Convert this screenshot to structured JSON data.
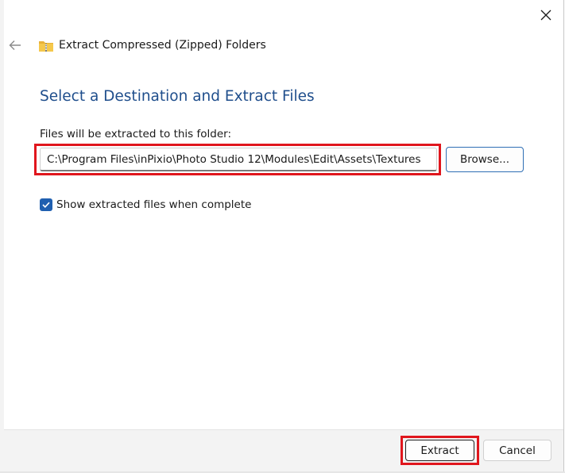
{
  "window": {
    "title": "Extract Compressed (Zipped) Folders",
    "back_icon": "arrow-left-icon",
    "folder_icon": "zipped-folder-icon",
    "close_icon": "close-icon"
  },
  "main": {
    "heading": "Select a Destination and Extract Files",
    "destination_label": "Files will be extracted to this folder:",
    "destination_path": "C:\\Program Files\\inPixio\\Photo Studio 12\\Modules\\Edit\\Assets\\Textures",
    "browse_label": "Browse...",
    "show_files_label": "Show extracted files when complete",
    "show_files_checked": true
  },
  "footer": {
    "extract_label": "Extract",
    "cancel_label": "Cancel"
  },
  "colors": {
    "heading": "#1f4e8c",
    "accent": "#1f5fb0",
    "highlight": "#e0161d"
  }
}
